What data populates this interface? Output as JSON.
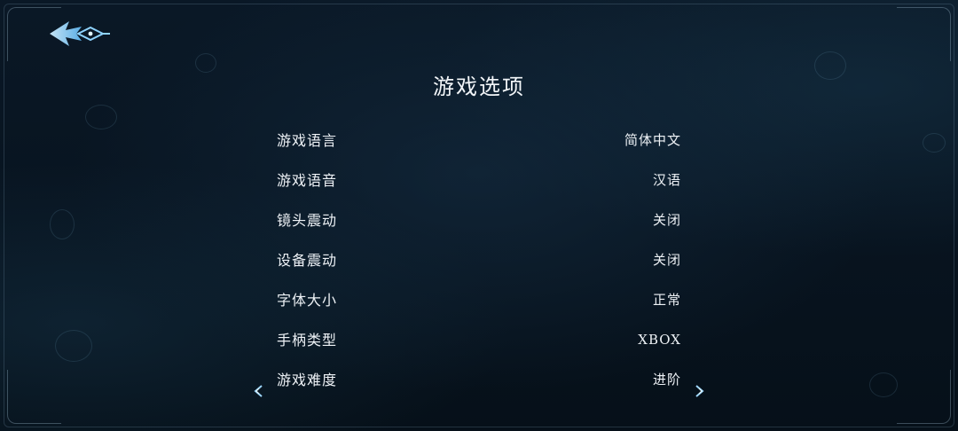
{
  "page": {
    "title": "游戏选项"
  },
  "icons": {
    "back": "back-arrow-icon",
    "selector_left": "chevron-left-icon",
    "selector_right": "chevron-right-icon"
  },
  "colors": {
    "background": "#07121d",
    "text": "#eef2f6",
    "accent": "#7fc8ff"
  },
  "options": [
    {
      "label": "游戏语言",
      "value": "简体中文"
    },
    {
      "label": "游戏语音",
      "value": "汉语"
    },
    {
      "label": "镜头震动",
      "value": "关闭"
    },
    {
      "label": "设备震动",
      "value": "关闭"
    },
    {
      "label": "字体大小",
      "value": "正常"
    },
    {
      "label": "手柄类型",
      "value": "XBOX"
    },
    {
      "label": "游戏难度",
      "value": "进阶",
      "selected": true
    }
  ]
}
